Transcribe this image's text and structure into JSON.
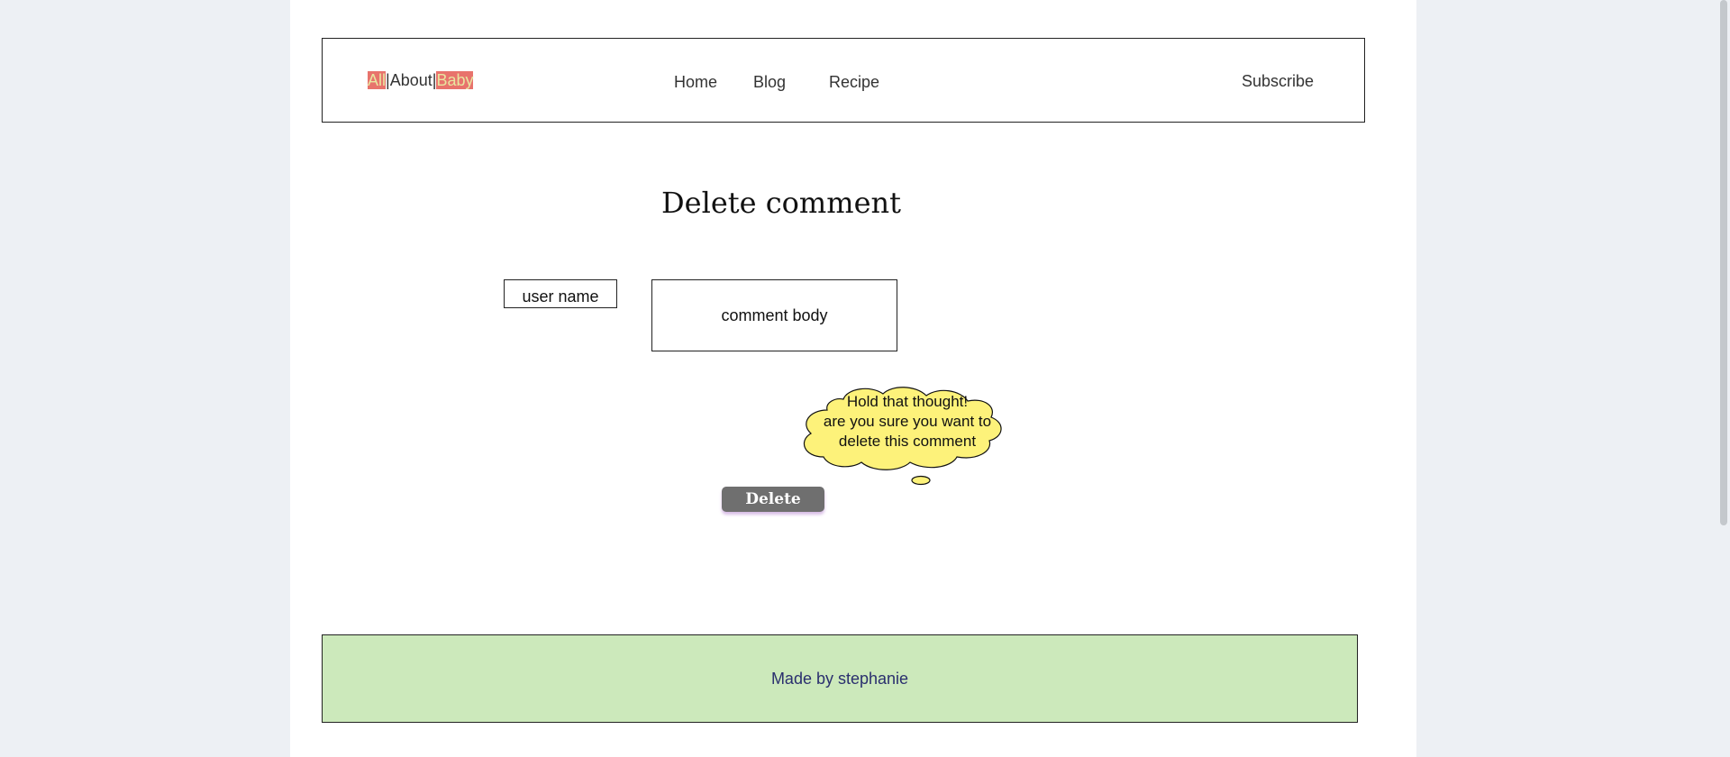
{
  "header": {
    "tags": [
      "All",
      "About",
      "Baby"
    ],
    "nav": [
      "Home",
      "Blog",
      "Recipe"
    ],
    "subscribe": "Subscribe"
  },
  "page_title": "Delete comment",
  "comment": {
    "user_name": "user name",
    "body": "comment body"
  },
  "thought_bubble": {
    "line1": "Hold that thought!",
    "line2": "are you sure you want to",
    "line3": "delete this comment"
  },
  "delete_button": "Delete",
  "footer": {
    "text": "Made by stephanie"
  },
  "colors": {
    "background": "#edf0f4",
    "tag_bg": "#e8736c",
    "tag_text": "#e8e6a0",
    "bubble": "#fdf27a",
    "button": "#6f6f6f",
    "footer_bg": "#cce9bb",
    "footer_text": "#2a2f6e"
  }
}
